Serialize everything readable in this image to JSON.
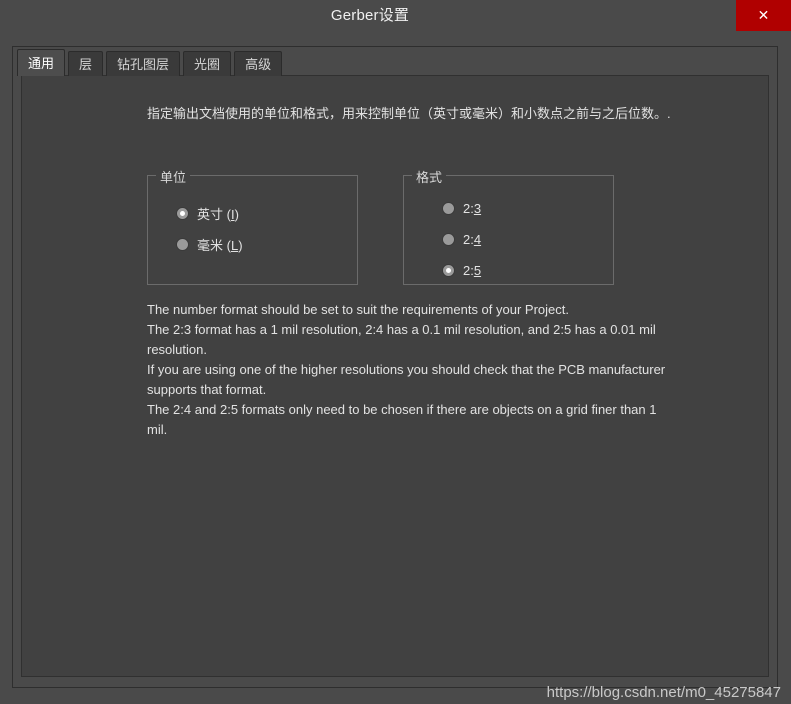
{
  "window": {
    "title": "Gerber设置",
    "close_label": "✕"
  },
  "tabs": [
    {
      "label": "通用",
      "active": true
    },
    {
      "label": "层",
      "active": false
    },
    {
      "label": "钻孔图层",
      "active": false
    },
    {
      "label": "光圈",
      "active": false
    },
    {
      "label": "高级",
      "active": false
    }
  ],
  "general": {
    "intro": "指定输出文档使用的单位和格式，用来控制单位（英寸或毫米）和小数点之前与之后位数。.",
    "units_group": {
      "title": "单位",
      "options": [
        {
          "label": "英寸 (",
          "accel": "I",
          "label_end": ")",
          "selected": true
        },
        {
          "label": "毫米 (",
          "accel": "L",
          "label_end": ")",
          "selected": false
        }
      ]
    },
    "format_group": {
      "title": "格式",
      "options": [
        {
          "label": "2:",
          "accel": "3",
          "label_end": "",
          "selected": false
        },
        {
          "label": "2:",
          "accel": "4",
          "label_end": "",
          "selected": false
        },
        {
          "label": "2:",
          "accel": "5",
          "label_end": "",
          "selected": true
        }
      ]
    },
    "help_lines": [
      "The number format should be set to suit the requirements of your Project.",
      "The 2:3 format has a 1 mil resolution, 2:4 has a 0.1 mil resolution, and 2:5 has a 0.01 mil resolution.",
      "If you are using one of the higher resolutions you should check that the PCB manufacturer supports that format.",
      "The 2:4 and 2:5 formats only need to be chosen if there are objects on a grid finer than 1 mil."
    ]
  },
  "watermark": "https://blog.csdn.net/m0_45275847"
}
